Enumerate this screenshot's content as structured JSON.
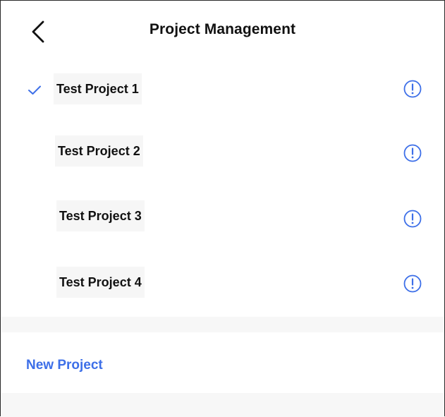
{
  "header": {
    "title": "Project Management",
    "back_icon": "chevron-left-icon"
  },
  "projects": [
    {
      "label": "Test Project 1",
      "selected": true
    },
    {
      "label": "Test Project 2",
      "selected": false
    },
    {
      "label": "Test Project 3",
      "selected": false
    },
    {
      "label": "Test Project 4",
      "selected": false
    }
  ],
  "row_icons": {
    "selected": "check-icon",
    "info": "info-icon"
  },
  "actions": {
    "new_project_label": "New Project"
  },
  "colors": {
    "accent": "#3d6fe8",
    "text": "#111111",
    "band": "#f7f7f7"
  }
}
